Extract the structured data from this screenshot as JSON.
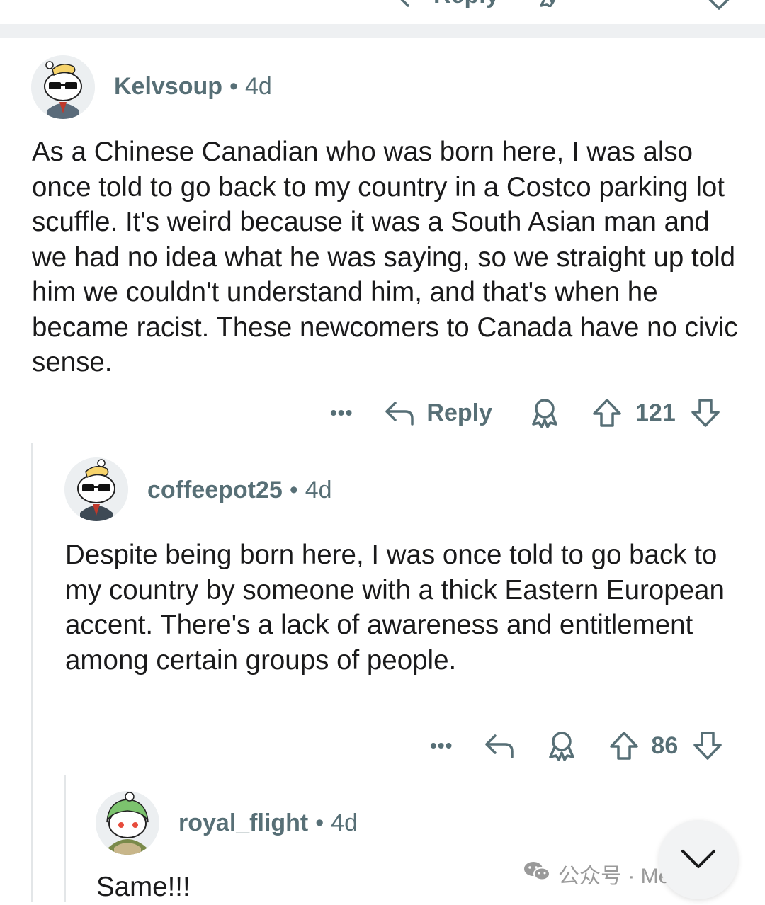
{
  "comments": [
    {
      "username": "Kelvsoup",
      "age": "4d",
      "text": "As a Chinese Canadian who was born here, I was also once told to go back to my country in a Costco parking lot scuffle. It's weird because it was a South Asian man and we had no idea what he was saying, so we straight up told him we couldn't understand him, and that's when he became racist. These newcomers to Canada have no civic sense.",
      "reply_label": "Reply",
      "vote_count": "121"
    },
    {
      "username": "coffeepot25",
      "age": "4d",
      "text": "Despite being born here, I was once told to go back to my country by someone with a thick Eastern European accent. There's a lack of awareness and entitlement among certain groups of people.",
      "vote_count": "86"
    },
    {
      "username": "royal_flight",
      "age": "4d",
      "text": "Same!!!"
    }
  ],
  "top_partial": {
    "reply_label": "Reply"
  },
  "meta_separator": "•",
  "more_glyph": "•••",
  "watermark": {
    "label": "公众号 · MeetInTo"
  },
  "icons": {
    "more": "more-dots-icon",
    "reply": "reply-arrow-icon",
    "award": "award-icon",
    "upvote": "upvote-arrow-icon",
    "downvote": "downvote-arrow-icon",
    "collapse": "chevron-down-icon"
  },
  "colors": {
    "text": "#1a1a1b",
    "meta": "#576f76",
    "divider": "#eef0f2",
    "thread_line": "#e3e6e8"
  }
}
